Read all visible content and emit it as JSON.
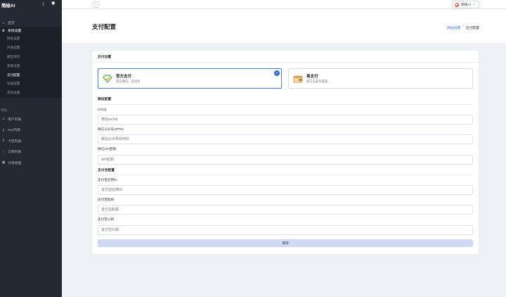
{
  "brand": {
    "name": "简绘AI"
  },
  "sidebar": {
    "home": "首页",
    "system_group": "系统设置",
    "sub_items": [
      "网站设置",
      "开关配置",
      "模型资料",
      "套餐设置",
      "支付配置",
      "绘画配置",
      "其他设置"
    ],
    "active_sub": 4,
    "nav_section": "导航",
    "nav_items": [
      {
        "label": "用户列表",
        "icon": "user-icon"
      },
      {
        "label": "Key列表",
        "icon": "key-icon"
      },
      {
        "label": "卡密列表",
        "icon": "card-icon"
      },
      {
        "label": "订单列表",
        "icon": "heart-icon"
      },
      {
        "label": "订单绘图",
        "icon": "image-icon"
      }
    ]
  },
  "topbar": {
    "menu": "⋮",
    "user": "简绘AI"
  },
  "page": {
    "title": "支付配置",
    "breadcrumb_link": "网站设置",
    "breadcrumb_sep": "/",
    "breadcrumb_current": "支付配置"
  },
  "card": {
    "title": "支付设置",
    "options": [
      {
        "title": "官方支付",
        "subtitle": "官方微信、支付宝"
      },
      {
        "title": "易支付",
        "subtitle": "第三方支付渠道"
      }
    ],
    "wechat_section": "微信配置",
    "alipay_section": "支付宝配置",
    "fields": [
      {
        "label": "mchid",
        "placeholder": "微信mchid"
      },
      {
        "label": "微信公众号APPID",
        "placeholder": "微信公众号APPID"
      },
      {
        "label": "微信API密钥",
        "placeholder": "API密钥"
      },
      {
        "label": "支付宝应用ID",
        "placeholder": "支付宝应用ID"
      },
      {
        "label": "支付宝私钥",
        "placeholder": "支付宝私钥"
      },
      {
        "label": "支付宝公钥",
        "placeholder": "支付宝公钥"
      }
    ],
    "save_label": "保存"
  },
  "colors": {
    "accent": "#3b6fd8",
    "sidebar_bg": "#232a33",
    "save_bg": "#cfd9f1"
  }
}
